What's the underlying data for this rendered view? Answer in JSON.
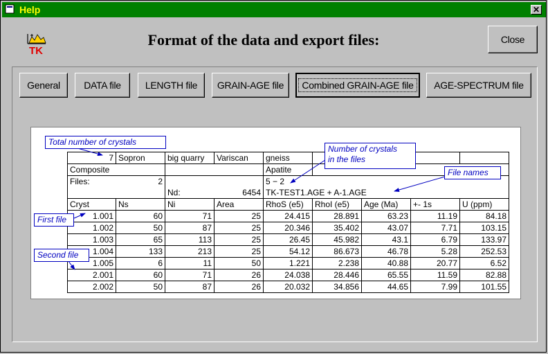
{
  "window": {
    "title": "Help",
    "close_glyph": "✕"
  },
  "logo": {
    "icon": "tk-logo-icon",
    "text": "TK"
  },
  "heading": "Format of the data and export files:",
  "close_button": "Close",
  "tabs": [
    {
      "label": "General"
    },
    {
      "label": "DATA file"
    },
    {
      "label": "LENGTH file"
    },
    {
      "label": "GRAIN-AGE file"
    },
    {
      "label": "Combined GRAIN-AGE file",
      "selected": true
    },
    {
      "label": "AGE-SPECTRUM file"
    }
  ],
  "callouts": {
    "total": "Total number of crystals",
    "num_crystals_1": "Number of crystals",
    "num_crystals_2": "in the files",
    "file_names": "File names",
    "first_file": "First file",
    "second_file": "Second file"
  },
  "sheet": {
    "row1": [
      "7",
      "Sopron",
      "big quarry",
      "Variscan",
      "gneiss"
    ],
    "row2": [
      "Composite",
      "Apatite"
    ],
    "row3": [
      "Files:",
      "2",
      "5  − 2"
    ],
    "row4": [
      "Nd:",
      "6454",
      "TK-TEST1.AGE + A-1.AGE"
    ],
    "headers": [
      "Cryst",
      "Ns",
      "Ni",
      "Area",
      "RhoS (e5)",
      "RhoI (e5)",
      "Age (Ma)",
      "+- 1s",
      "U (ppm)"
    ],
    "rows": [
      [
        "1.001",
        "60",
        "71",
        "25",
        "24.415",
        "28.891",
        "63.23",
        "11.19",
        "84.18"
      ],
      [
        "1.002",
        "50",
        "87",
        "25",
        "20.346",
        "35.402",
        "43.07",
        "7.71",
        "103.15"
      ],
      [
        "1.003",
        "65",
        "113",
        "25",
        "26.45",
        "45.982",
        "43.1",
        "6.79",
        "133.97"
      ],
      [
        "1.004",
        "133",
        "213",
        "25",
        "54.12",
        "86.673",
        "46.78",
        "5.28",
        "252.53"
      ],
      [
        "1.005",
        "6",
        "11",
        "50",
        "1.221",
        "2.238",
        "40.88",
        "20.77",
        "6.52"
      ],
      [
        "2.001",
        "60",
        "71",
        "26",
        "24.038",
        "28.446",
        "65.55",
        "11.59",
        "82.88"
      ],
      [
        "2.002",
        "50",
        "87",
        "26",
        "20.032",
        "34.856",
        "44.65",
        "7.99",
        "101.55"
      ]
    ]
  },
  "colors": {
    "titlebar": "#008000",
    "title_text": "#ffff00",
    "callout": "#0000c0"
  }
}
